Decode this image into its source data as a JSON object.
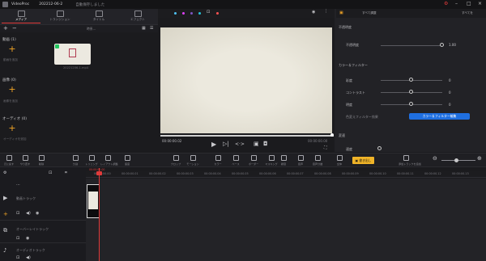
{
  "app": {
    "name": "VideoProc",
    "project": "202212-06-2",
    "status": "自動保存しました"
  },
  "media_tabs": [
    {
      "label": "メディア",
      "icon": "media-icon"
    },
    {
      "label": "トランジション",
      "icon": "transition-icon"
    },
    {
      "label": "タイトル",
      "icon": "title-icon"
    },
    {
      "label": "エフェクト",
      "icon": "effect-icon"
    }
  ],
  "media": {
    "filter_label": "時系...",
    "sections": [
      {
        "label": "動画 (1)",
        "hint": "動画を追加"
      },
      {
        "label": "画像 (0)",
        "hint": "画像を追加"
      },
      {
        "label": "オーディオ (0)",
        "hint": "オーディオを追加"
      }
    ],
    "thumb_caption": "20221206-1.mp4"
  },
  "preview": {
    "timecode_left": "00:00:00.02",
    "timecode_right": "00:00:00.00",
    "color_dots": [
      "#4fc3f7",
      "#e040fb",
      "#7e57c2",
      "#26c6da",
      "#ff5252"
    ]
  },
  "right_panel": {
    "tabs": [
      "すべて調整",
      "すべてを"
    ],
    "opacity_section": "不透明度",
    "opacity_label": "不透明度",
    "opacity_value": "1.00",
    "color_section": "カラー＆フィルター",
    "color_rows": [
      {
        "label": "彩度",
        "value": "0"
      },
      {
        "label": "コントラスト",
        "value": "0"
      },
      {
        "label": "明度",
        "value": "0"
      }
    ],
    "color_filter_label": "色変えフィルター効果",
    "color_filter_button": "カラー＆フィルター編集",
    "speed_section": "変速",
    "speed_label": "速度"
  },
  "toolbar": {
    "tools": [
      {
        "label": "元に戻す",
        "icon": "undo-icon"
      },
      {
        "label": "やり直す",
        "icon": "redo-icon"
      },
      {
        "label": "削除",
        "icon": "delete-icon"
      },
      {
        "label": "分割",
        "icon": "split-icon"
      },
      {
        "label": "トリミング",
        "icon": "trim-icon"
      },
      {
        "label": "レイアウト調整",
        "icon": "layout-icon"
      },
      {
        "label": "速度",
        "icon": "speed-icon"
      },
      {
        "label": "クロップ",
        "icon": "crop-icon"
      },
      {
        "label": "モーション",
        "icon": "motion-icon"
      },
      {
        "label": "カラー",
        "icon": "color-icon"
      },
      {
        "label": "ベース",
        "icon": "base-icon"
      },
      {
        "label": "ボーダー",
        "icon": "border-icon"
      },
      {
        "label": "マスキング",
        "icon": "mask-icon"
      },
      {
        "label": "録音",
        "icon": "mic-icon"
      },
      {
        "label": "音声",
        "icon": "audio-icon"
      },
      {
        "label": "音声分離",
        "icon": "separate-icon"
      }
    ],
    "fit_label": "全体",
    "export_label": "書き出し",
    "add_track_label": "添加トラックを追加"
  },
  "timeline": {
    "ruler_ticks": [
      "00:00:00.00",
      "00:00:00.01",
      "00:00:00.02",
      "00:00:00.03",
      "00:00:00.04",
      "00:00:00.05",
      "00:00:00.06",
      "00:00:00.07",
      "00:00:00.08",
      "00:00:00.09",
      "00:00:00.10",
      "00:00:00.11",
      "00:00:00.12",
      "00:00:00.13"
    ],
    "playhead_time": "00:00:00.00",
    "tracks": [
      {
        "label": "動画トラック",
        "icon": "video-track-icon"
      },
      {
        "label": "オーバーレイトラック",
        "icon": "overlay-track-icon"
      },
      {
        "label": "オーディオトラック",
        "icon": "audio-track-icon"
      }
    ]
  }
}
